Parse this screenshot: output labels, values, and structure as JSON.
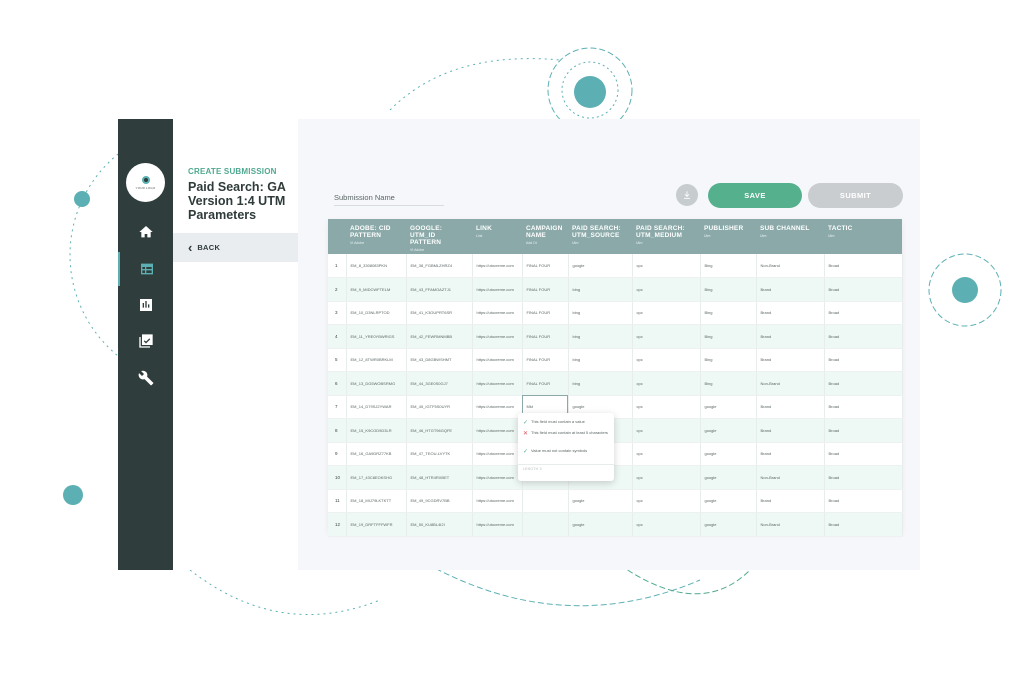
{
  "sidebar": {
    "logo_text": "YOUR LOGO",
    "items": [
      {
        "icon": "home-icon"
      },
      {
        "icon": "table-icon"
      },
      {
        "icon": "bar-chart-icon"
      },
      {
        "icon": "checklist-icon"
      },
      {
        "icon": "wrench-icon"
      }
    ]
  },
  "panel": {
    "kicker": "CREATE SUBMISSION",
    "title": "Paid Search: GA Version 1:4 UTM Parameters",
    "back_label": "BACK"
  },
  "form": {
    "submission_label": "Submission Name",
    "save_label": "SAVE",
    "submit_label": "SUBMIT"
  },
  "table": {
    "columns": [
      {
        "label": "",
        "sub": ""
      },
      {
        "label": "ADOBE: CID PATTERN",
        "sub": "Vt Adobe"
      },
      {
        "label": "GOOGLE: UTM_ID PATTERN",
        "sub": "Vt Adobe"
      },
      {
        "label": "LINK",
        "sub": "Link"
      },
      {
        "label": "CAMPAIGN NAME",
        "sub": "Add Dt"
      },
      {
        "label": "PAID SEARCH: UTM_SOURCE",
        "sub": "Utm"
      },
      {
        "label": "PAID SEARCH: UTM_MEDIUM",
        "sub": "Utm"
      },
      {
        "label": "PUBLISHER",
        "sub": "Utm"
      },
      {
        "label": "SUB CHANNEL",
        "sub": "Utm"
      },
      {
        "label": "TACTIC",
        "sub": "Utm"
      }
    ],
    "rows": [
      [
        "1",
        "EM_8_3308083PKN",
        "EM_38_FGBMLZHRZ4",
        "https://utocreme.com",
        "FINAL FOUR",
        "google",
        "cpc",
        "Bing",
        "Non-Brand",
        "Broad"
      ],
      [
        "2",
        "EM_9_MIDCWFTELM",
        "EM_43_FFAMOAZTJ1",
        "https://utocreme.com",
        "FINAL FOUR",
        "bing",
        "cpc",
        "Bing",
        "Brand",
        "Broad"
      ],
      [
        "3",
        "EM_10_D3NLRPTOD",
        "EM_41_K3OUPRT6SR",
        "https://utocreme.com",
        "FINAL FOUR",
        "bing",
        "cpc",
        "Bing",
        "Brand",
        "Broad"
      ],
      [
        "4",
        "EM_11_YRE0YBWRIGS",
        "EM_42_FEWRMNMBB",
        "https://utocreme.com",
        "FINAL FOUR",
        "bing",
        "cpc",
        "Bing",
        "Brand",
        "Broad"
      ],
      [
        "5",
        "EM_12_8TWR0BRKLM",
        "EM_43_D8GBWSHMT",
        "https://utocreme.com",
        "FINAL FOUR",
        "bing",
        "cpc",
        "Bing",
        "Brand",
        "Broad"
      ],
      [
        "6",
        "EM_13_DG5WOBSRMG",
        "EM_44_3GE0S0GJ7",
        "https://utocreme.com",
        "FINAL FOUR",
        "bing",
        "cpc",
        "Bing",
        "Non-Brand",
        "Broad"
      ],
      [
        "7",
        "EM_14_D79SJ2YWAR",
        "EM_45_IGTF5S0UYR",
        "https://utocreme.com",
        "Mkt",
        "google",
        "cpc",
        "google",
        "Brand",
        "Broad"
      ],
      [
        "8",
        "EM_15_K9COD9D3LR",
        "EM_46_HTGT96GQFE",
        "https://utocreme.com",
        "",
        "",
        "cpc",
        "google",
        "Brand",
        "Broad"
      ],
      [
        "9",
        "EM_16_GA9DRZ77KB",
        "EM_47_TEOU-LVYTK",
        "https://utocreme.com",
        "",
        "",
        "cpc",
        "google",
        "Brand",
        "Broad"
      ],
      [
        "10",
        "EM_17_43C8EOKSHG",
        "EM_48_HTR4RXBET",
        "https://utocreme.com",
        "",
        "",
        "cpc",
        "google",
        "Non-Brand",
        "Broad"
      ],
      [
        "11",
        "EM_18_MIJ79LKTKTT",
        "EM_49_9CGDRV7BB",
        "https://utocreme.com",
        "",
        "google",
        "cpc",
        "google",
        "Brand",
        "Broad"
      ],
      [
        "12",
        "EM_19_DRFTFFFWFR",
        "EM_50_KU8BL4I2I",
        "https://utocreme.com",
        "",
        "google",
        "cpc",
        "google",
        "Non-Brand",
        "Broad"
      ]
    ]
  },
  "validation": {
    "rules": [
      {
        "status": "ok",
        "text": "This field must contain a value"
      },
      {
        "status": "bad",
        "text": "This field must contain at least 5 characters"
      },
      {
        "status": "ok",
        "text": "Value must not contain symbols"
      }
    ],
    "counter": "LENGTH 3"
  },
  "colors": {
    "rail": "#2f3d3c",
    "accent": "#5cb0b4",
    "save": "#55b08d",
    "header": "#8ba9a9",
    "row_alt": "#eef8f4"
  }
}
